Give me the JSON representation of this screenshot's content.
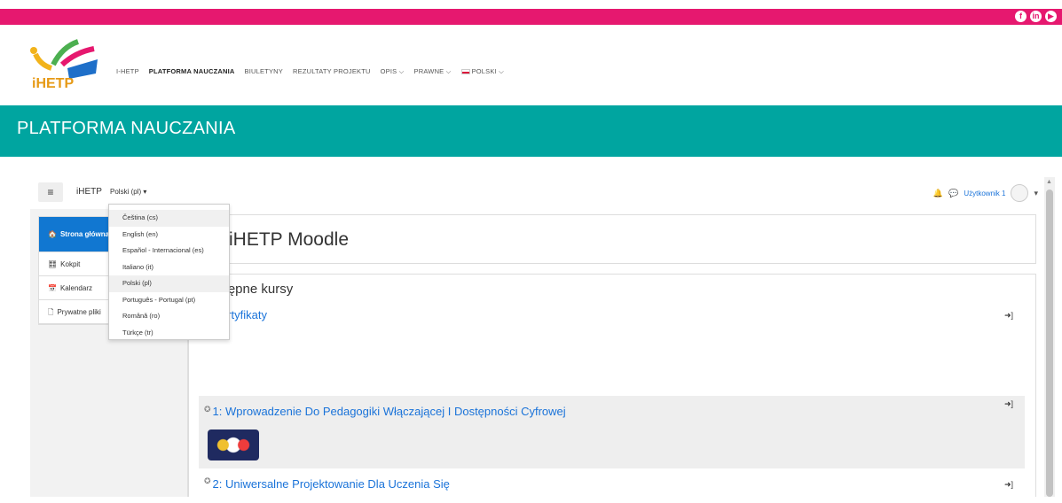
{
  "social": [
    "f",
    "in",
    "▶"
  ],
  "nav": {
    "items": [
      "I-HETP",
      "PLATFORMA NAUCZANIA",
      "BIULETYNY",
      "REZULTATY PROJEKTU",
      "OPIS ⌵",
      "PRAWNE ⌵"
    ],
    "lang": "POLSKI ⌵"
  },
  "banner": {
    "title": "PLATFORMA NAUCZANIA"
  },
  "moodlebar": {
    "brand": "iHETP",
    "language": "Polski (pl) ▾",
    "user": "Użytkownik 1"
  },
  "drawer": {
    "items": [
      {
        "icon": "🏠",
        "label": "Strona główna"
      },
      {
        "icon": "🎛",
        "label": "Kokpit"
      },
      {
        "icon": "📅",
        "label": "Kalendarz"
      },
      {
        "icon": "🗋",
        "label": "Prywatne pliki"
      }
    ]
  },
  "main": {
    "site_title": "iHETP Moodle",
    "section_title": "Dostępne kursy",
    "courses": [
      {
        "title": "Certyfikaty"
      },
      {
        "title": "1: Wprowadzenie Do Pedagogiki Włączającej I Dostępności Cyfrowej"
      },
      {
        "title": "2: Uniwersalne Projektowanie Dla Uczenia Się"
      }
    ]
  },
  "dropdown": {
    "options": [
      "Čeština (cs)",
      "English (en)",
      "Español - Internacional (es)",
      "Italiano (it)",
      "Polski (pl)",
      "Português - Portugal (pt)",
      "Română (ro)",
      "Türkçe (tr)"
    ]
  },
  "colors": {
    "pink": "#e6186f",
    "teal": "#00a5a0",
    "blue": "#1177d1",
    "link": "#1a73d9"
  }
}
